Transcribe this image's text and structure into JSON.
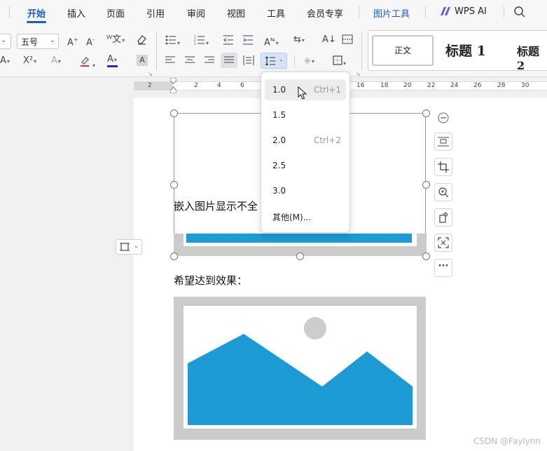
{
  "tabs": [
    {
      "label": "开始",
      "active": true
    },
    {
      "label": "插入"
    },
    {
      "label": "页面"
    },
    {
      "label": "引用"
    },
    {
      "label": "审阅"
    },
    {
      "label": "视图"
    },
    {
      "label": "工具"
    },
    {
      "label": "会员专享"
    },
    {
      "label": "图片工具"
    },
    {
      "label": "WPS AI"
    }
  ],
  "ribbon": {
    "font_size_value": "五号",
    "styles": {
      "normal": "正文",
      "heading1": "标题 1",
      "heading2": "标题 2"
    }
  },
  "ruler": {
    "labels": [
      "2",
      "2",
      "4",
      "6",
      "16",
      "18",
      "20",
      "22",
      "24",
      "26",
      "28",
      "30"
    ]
  },
  "document": {
    "para1": "嵌入图片显示不全",
    "para2": "希望达到效果："
  },
  "line_spacing_menu": {
    "items": [
      {
        "label": "1.0",
        "shortcut": "Ctrl+1",
        "highlighted": true
      },
      {
        "label": "1.5",
        "shortcut": ""
      },
      {
        "label": "2.0",
        "shortcut": "Ctrl+2"
      },
      {
        "label": "2.5",
        "shortcut": ""
      },
      {
        "label": "3.0",
        "shortcut": ""
      },
      {
        "label": "其他(M)...",
        "shortcut": ""
      }
    ]
  },
  "watermark": "CSDN @Faylynn",
  "colors": {
    "accent": "#1a5ec4",
    "image_blue": "#1b9ad6",
    "image_frame": "#cbcbcb",
    "sun": "#cccccc"
  },
  "icons": {
    "search": "search-icon",
    "wps_ai_logo": "wps-ai-logo-icon"
  }
}
